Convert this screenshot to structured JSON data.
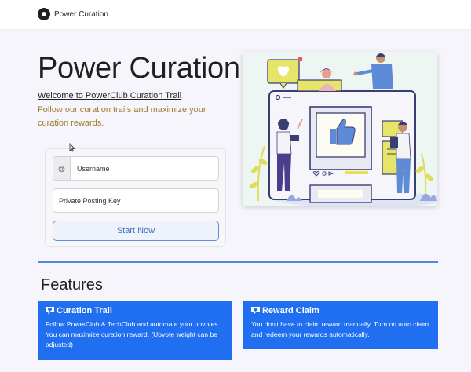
{
  "navbar": {
    "logo_icon": "power-curation-logo-icon",
    "brand_name": "Power Curation"
  },
  "hero": {
    "title": "Power Curation",
    "welcome_link": "Welcome to PowerClub Curation Trail",
    "lead": "Follow our curation trails and maximize your curation rewards."
  },
  "login": {
    "username_addon": "@",
    "username_placeholder": "Username",
    "key_placeholder": "Private Posting Key",
    "start_label": "Start Now"
  },
  "features": {
    "title": "Features",
    "items": [
      {
        "icon": "heart-chat-icon",
        "title": "Curation Trail",
        "text": "Follow PowerClub & TechClub and automate your upvotes. You can maximize curation reward. (Upvote weight can be adjusted)"
      },
      {
        "icon": "heart-chat-icon",
        "title": "Reward Claim",
        "text": "You don't have to claim reward manually. Turn on auto claim and redeem your rewards automatically."
      }
    ]
  },
  "colors": {
    "accent": "#1f6ff0",
    "divider": "#4f86e0",
    "lead_text": "#a07a2c"
  }
}
